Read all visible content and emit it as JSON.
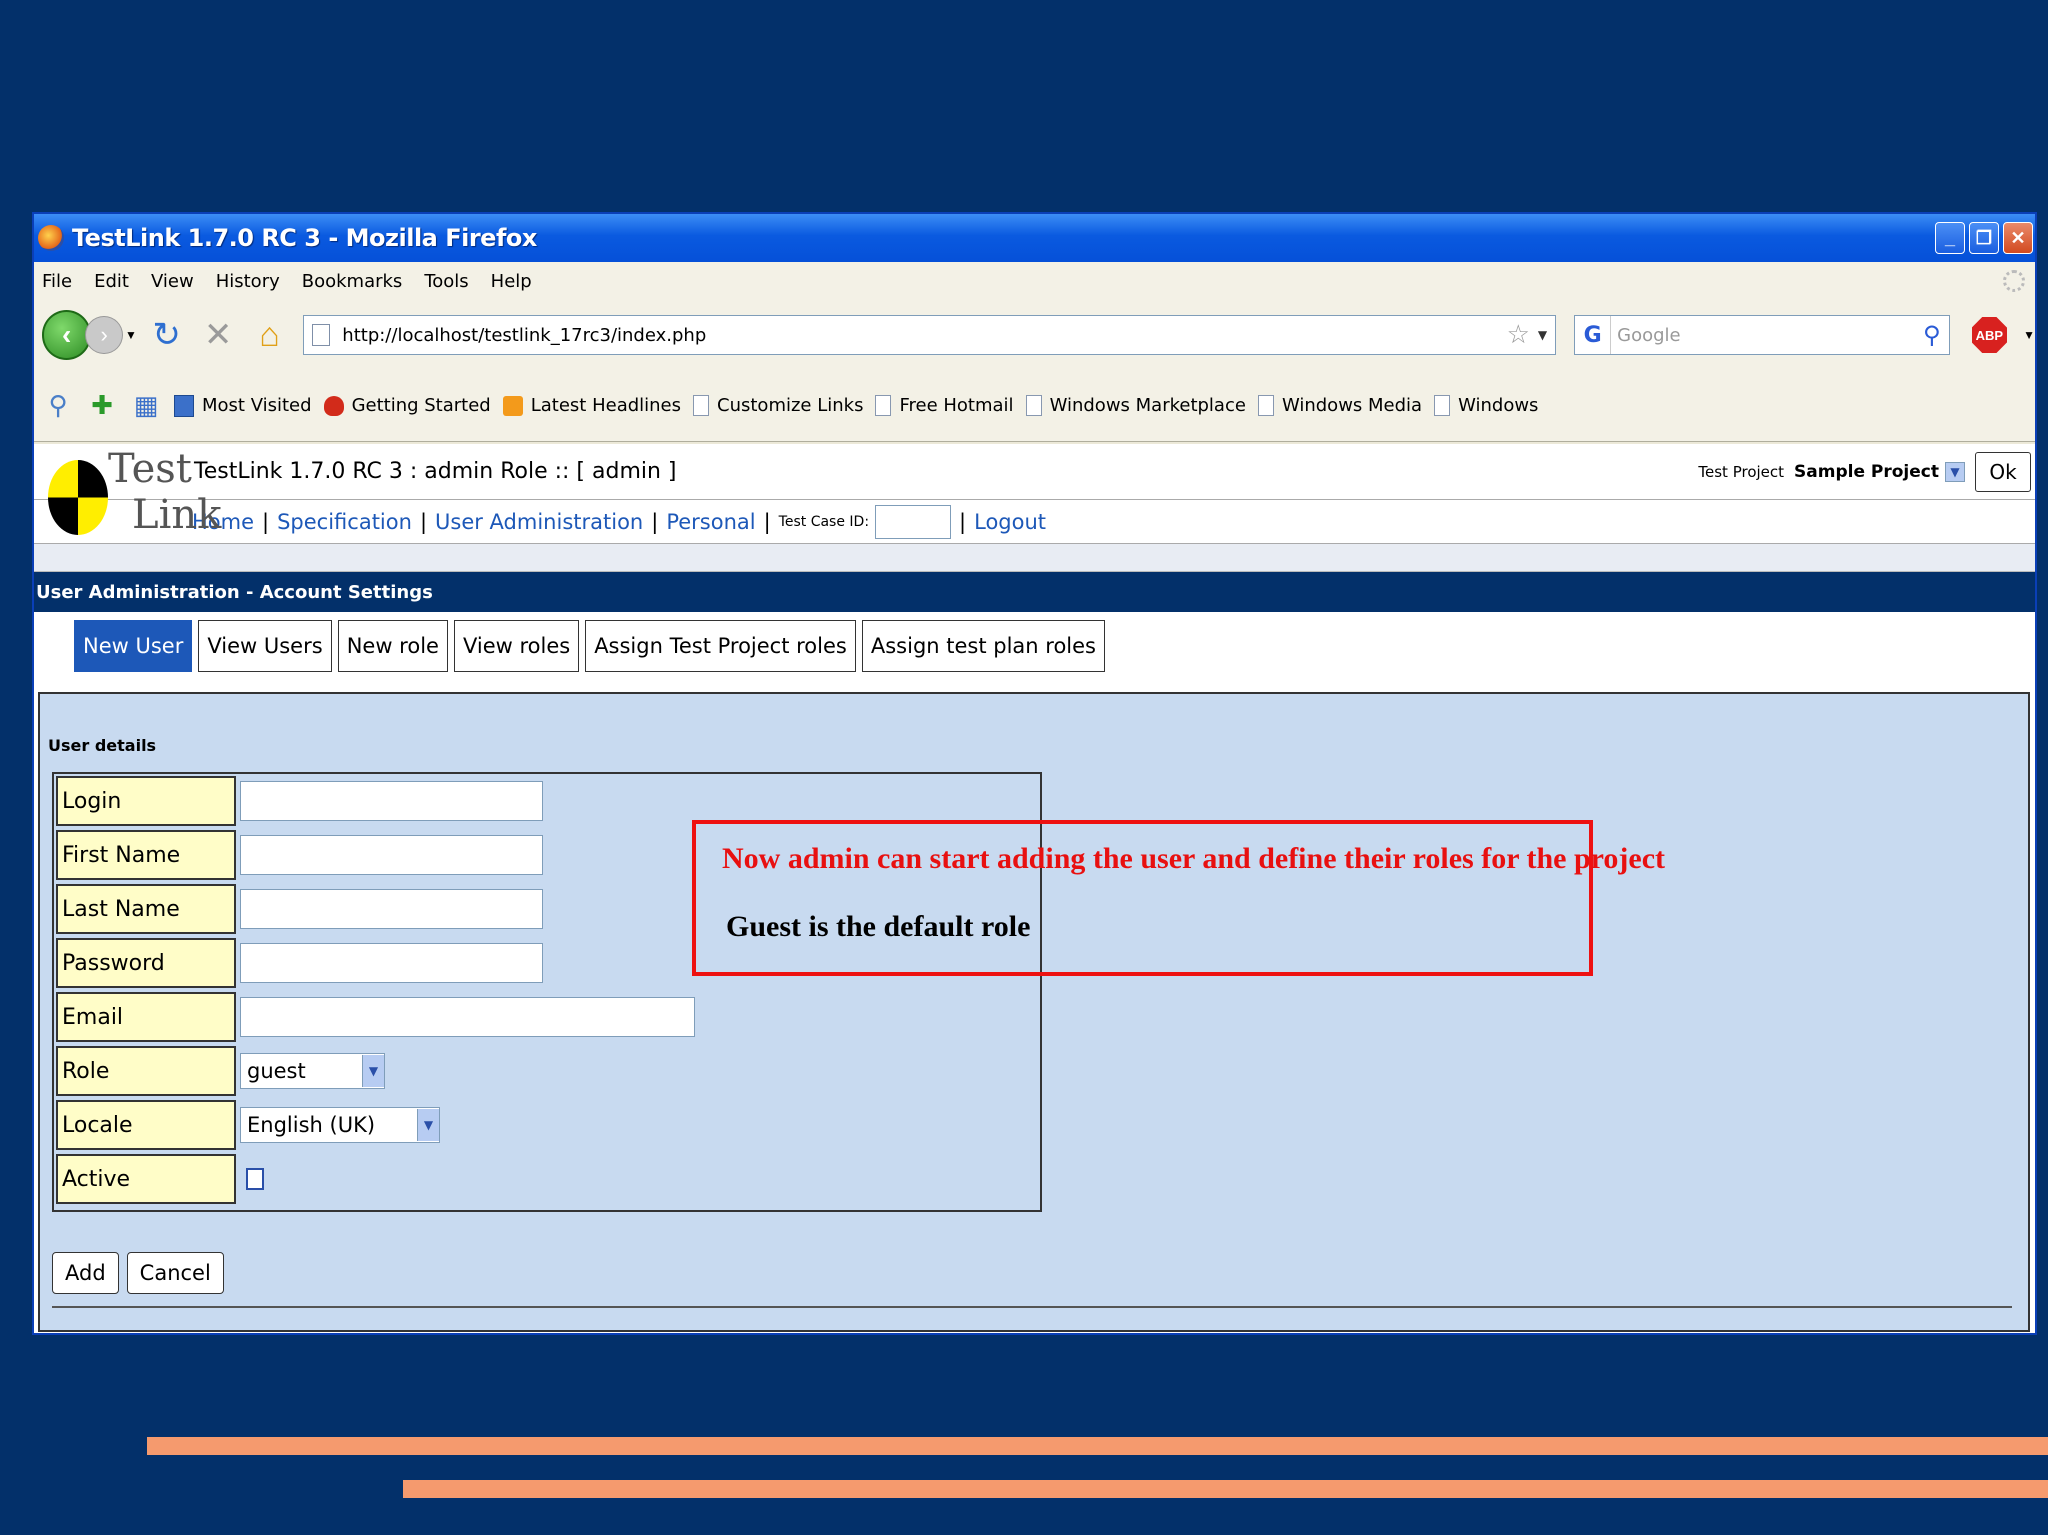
{
  "window": {
    "title": "TestLink 1.7.0 RC 3 - Mozilla Firefox"
  },
  "menu": [
    "File",
    "Edit",
    "View",
    "History",
    "Bookmarks",
    "Tools",
    "Help"
  ],
  "toolbar": {
    "url": "http://localhost/testlink_17rc3/index.php",
    "search_placeholder": "Google",
    "abp_label": "ABP"
  },
  "bookmarks": [
    "Most Visited",
    "Getting Started",
    "Latest Headlines",
    "Customize Links",
    "Free Hotmail",
    "Windows Marketplace",
    "Windows Media",
    "Windows"
  ],
  "testlink": {
    "logo_top": "Test",
    "logo_bottom": "Link",
    "title": "TestLink 1.7.0 RC 3 : admin Role :: [ admin ]",
    "project_label": "Test Project",
    "project_value": "Sample Project",
    "ok_label": "Ok",
    "nav": [
      "Home",
      "Specification",
      "User Administration",
      "Personal"
    ],
    "testcase_id_label": "Test Case ID:",
    "logout": "Logout"
  },
  "section": {
    "title": "User Administration - Account Settings"
  },
  "tabs": [
    "New User",
    "View Users",
    "New role",
    "View roles",
    "Assign Test Project roles",
    "Assign test plan roles"
  ],
  "form": {
    "heading": "User details",
    "fields": {
      "login": "Login",
      "first_name": "First Name",
      "last_name": "Last Name",
      "password": "Password",
      "email": "Email",
      "role": "Role",
      "locale": "Locale",
      "active": "Active"
    },
    "role_value": "guest",
    "locale_value": "English (UK)",
    "add_label": "Add",
    "cancel_label": "Cancel"
  },
  "callout": {
    "line1": "Now admin can start adding the user  and define their roles for the project",
    "line2": "Guest is the default role"
  },
  "colors": {
    "slide_bg": "#03306a",
    "stripe": "#f59a6e",
    "callout_red": "#e81010",
    "label_bg": "#fffdc8",
    "content_bg": "#c8daf0"
  }
}
